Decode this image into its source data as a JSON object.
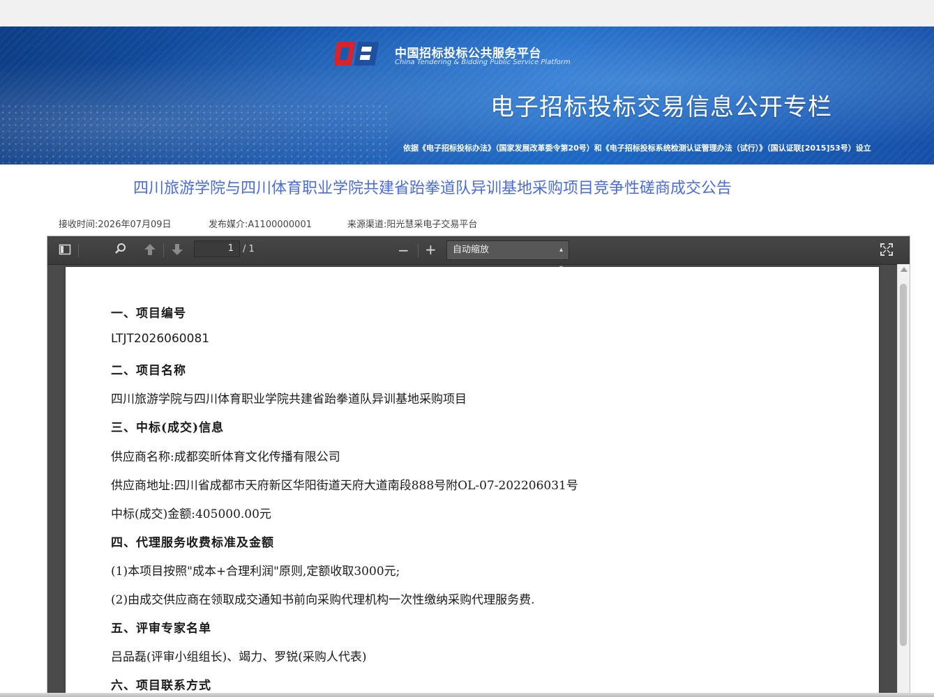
{
  "header": {
    "platform_name": "中国招标投标公共服务平台",
    "platform_name_en": "China Tendering & Bidding Public Service Platform",
    "column_title": "电子招标投标交易信息公开专栏",
    "basis": "依据《电子招标投标办法》（国家发展改革委令第20号）和《电子招标投标系统检测认证管理办法（试行）》（国认证联[2015]53号）设立"
  },
  "notice": {
    "title": "四川旅游学院与四川体育职业学院共建省跆拳道队异训基地采购项目竞争性磋商成交公告",
    "received": "接收时间:2026年07月09日",
    "media": "发布媒介:A1100000001",
    "source": "来源渠道:阳光慧采电子交易平台"
  },
  "viewer": {
    "page_current": "1",
    "page_total": "/ 1",
    "zoom_label": "自动缩放",
    "zoom_out": "−",
    "zoom_in": "+"
  },
  "document": {
    "lines": [
      "一、项目编号",
      "LTJT2026060081",
      "二、项目名称",
      "四川旅游学院与四川体育职业学院共建省跆拳道队异训基地采购项目",
      "三、中标(成交)信息",
      "供应商名称:成都奕昕体育文化传播有限公司",
      "供应商地址:四川省成都市天府新区华阳街道天府大道南段888号附OL-07-202206031号",
      "中标(成交)金额:405000.00元",
      "四、代理服务收费标准及金额",
      "(1)本项目按照\"成本+合理利润\"原则,定额收取3000元;",
      "(2)由成交供应商在领取成交通知书前向采购代理机构一次性缴纳采购代理服务费.",
      "五、评审专家名单",
      "吕品磊(评审小组组长)、竭力、罗锐(采购人代表)",
      "六、项目联系方式"
    ]
  },
  "icons": {
    "sidebar_toggle": "sidebar-toggle-icon",
    "search": "search-icon",
    "prev_page": "arrow-up-icon",
    "next_page": "arrow-down-icon",
    "fullscreen": "fullscreen-icon",
    "dropdown": "caret-updown-icon"
  },
  "colors": {
    "title_blue": "#4a6cd4",
    "banner_blue": "#1758b0",
    "toolbar_dark": "#474747"
  }
}
